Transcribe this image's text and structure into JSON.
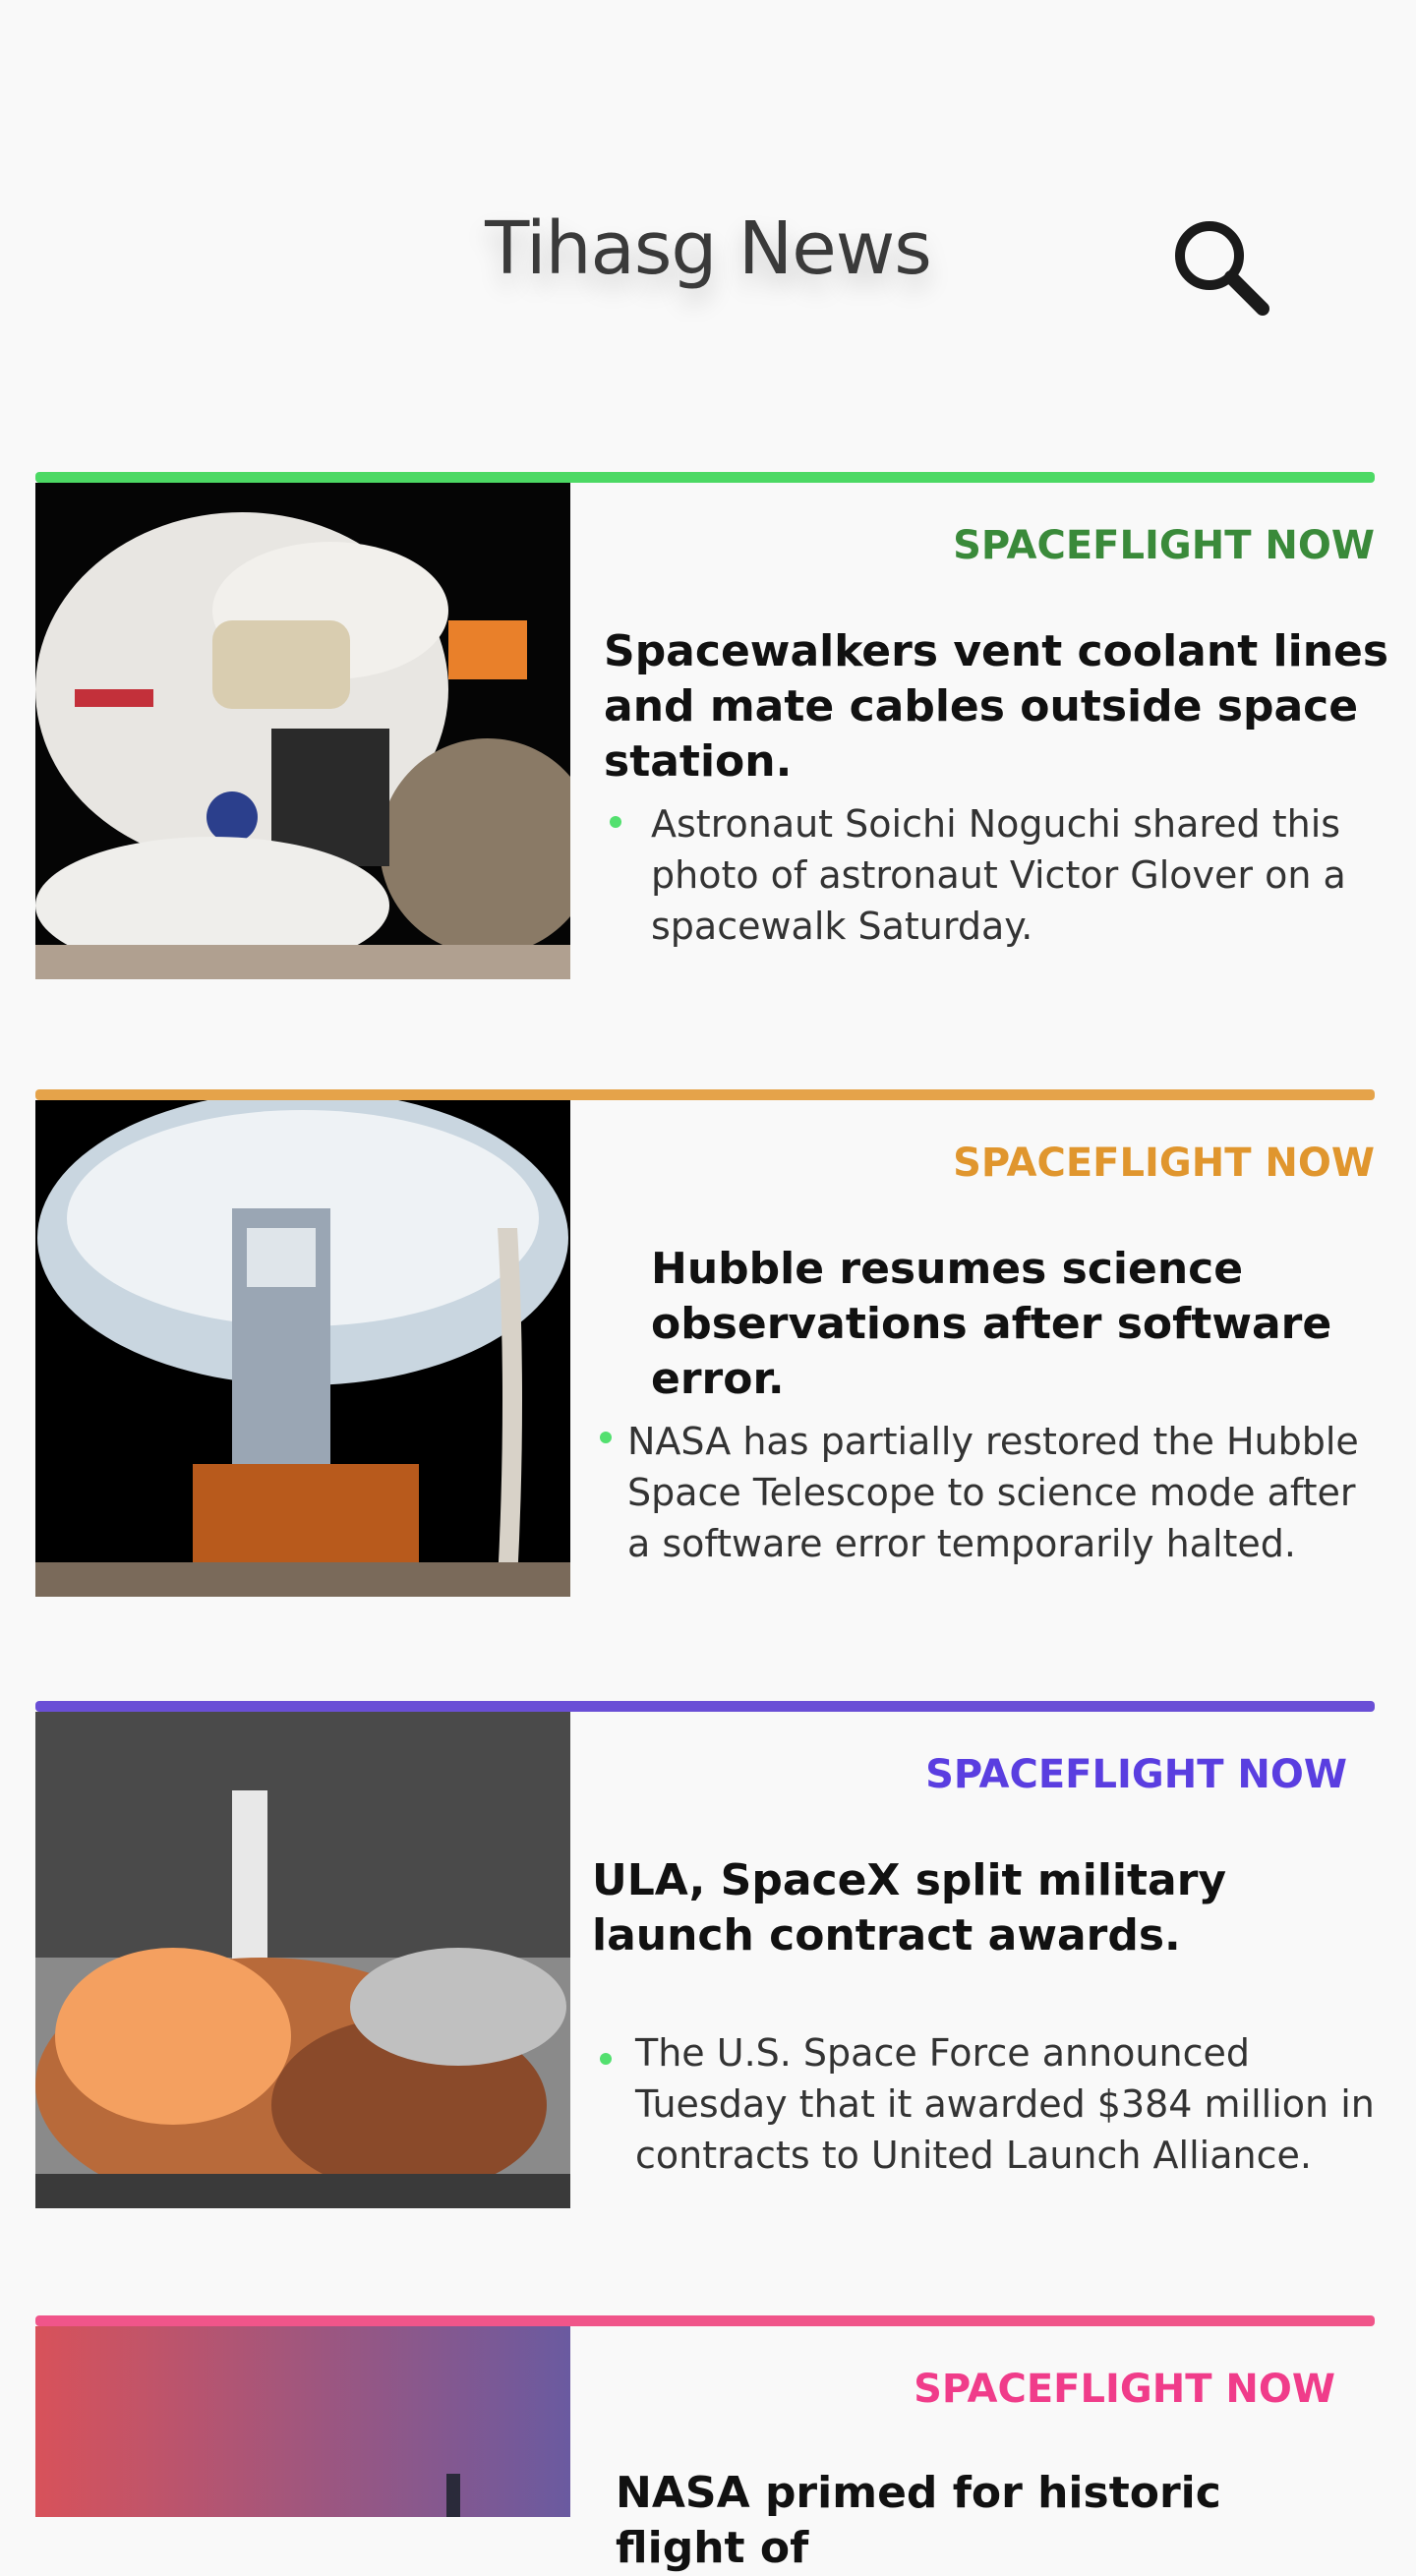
{
  "header": {
    "title": "Tihasg News",
    "search_icon": "search-icon"
  },
  "articles": [
    {
      "source": "SPACEFLIGHT NOW",
      "accent": "#4cd964",
      "source_color": "#3a8a3a",
      "title": "Spacewalkers vent coolant lines and mate cables outside space station.",
      "summary": "Astronaut Soichi Noguchi shared this photo of astronaut Victor Glover on a spacewalk Saturday."
    },
    {
      "source": "SPACEFLIGHT NOW",
      "accent": "#e5a34a",
      "source_color": "#e0962e",
      "title": "Hubble resumes science observations after software error.",
      "summary": "NASA has partially restored the Hubble Space Telescope to science mode after a software error temporarily halted."
    },
    {
      "source": "SPACEFLIGHT NOW",
      "accent": "#6a4fd6",
      "source_color": "#5a3ee0",
      "title": "ULA, SpaceX split military launch contract awards.",
      "summary": "The U.S. Space Force announced Tuesday that it awarded $384 million in contracts to United Launch Alliance."
    },
    {
      "source": "SPACEFLIGHT NOW",
      "accent": "#f0558a",
      "source_color": "#f03c8a",
      "title": "NASA primed for historic flight of",
      "summary": ""
    }
  ]
}
